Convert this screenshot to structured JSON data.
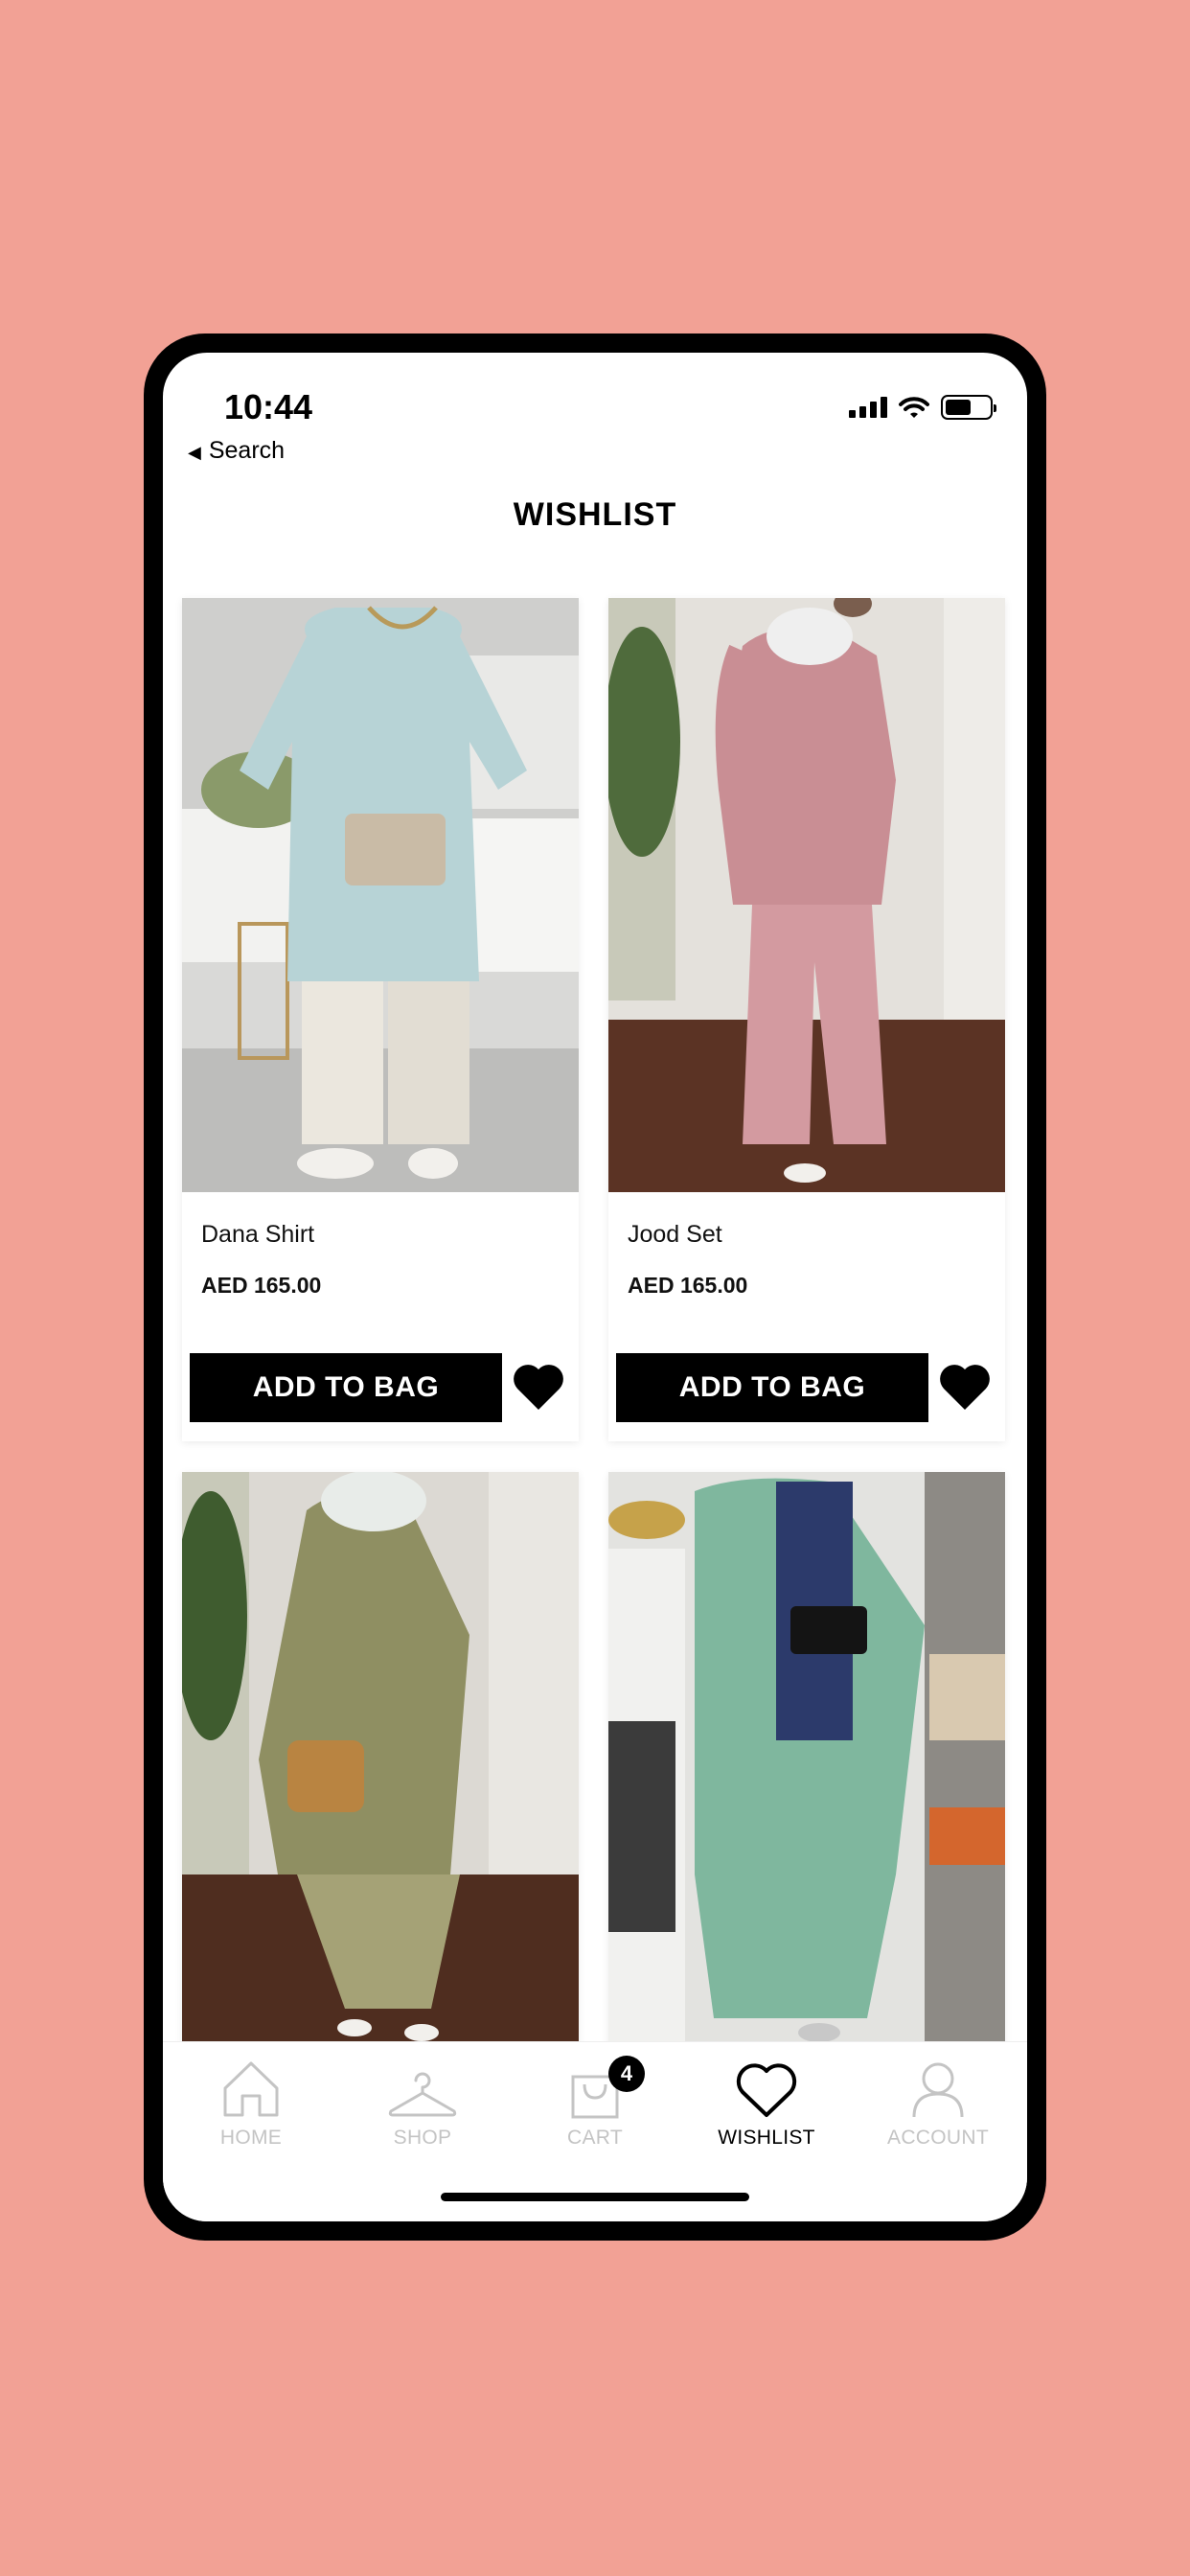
{
  "status": {
    "time": "10:44",
    "back_label": "Search"
  },
  "page": {
    "title": "WISHLIST"
  },
  "products": [
    {
      "name": "Dana Shirt",
      "price": "AED 165.00",
      "add_label": "ADD TO BAG"
    },
    {
      "name": "Jood Set",
      "price": "AED 165.00",
      "add_label": "ADD TO BAG"
    }
  ],
  "tabs": [
    {
      "label": "HOME",
      "icon": "home-icon",
      "active": false
    },
    {
      "label": "SHOP",
      "icon": "hanger-icon",
      "active": false
    },
    {
      "label": "CART",
      "icon": "bag-icon",
      "active": false,
      "badge": "4"
    },
    {
      "label": "WISHLIST",
      "icon": "heart-icon",
      "active": true
    },
    {
      "label": "ACCOUNT",
      "icon": "person-icon",
      "active": false
    }
  ],
  "colors": {
    "background": "#f2a195",
    "accent": "#000000",
    "inactive_tab": "#c4c4c4"
  }
}
